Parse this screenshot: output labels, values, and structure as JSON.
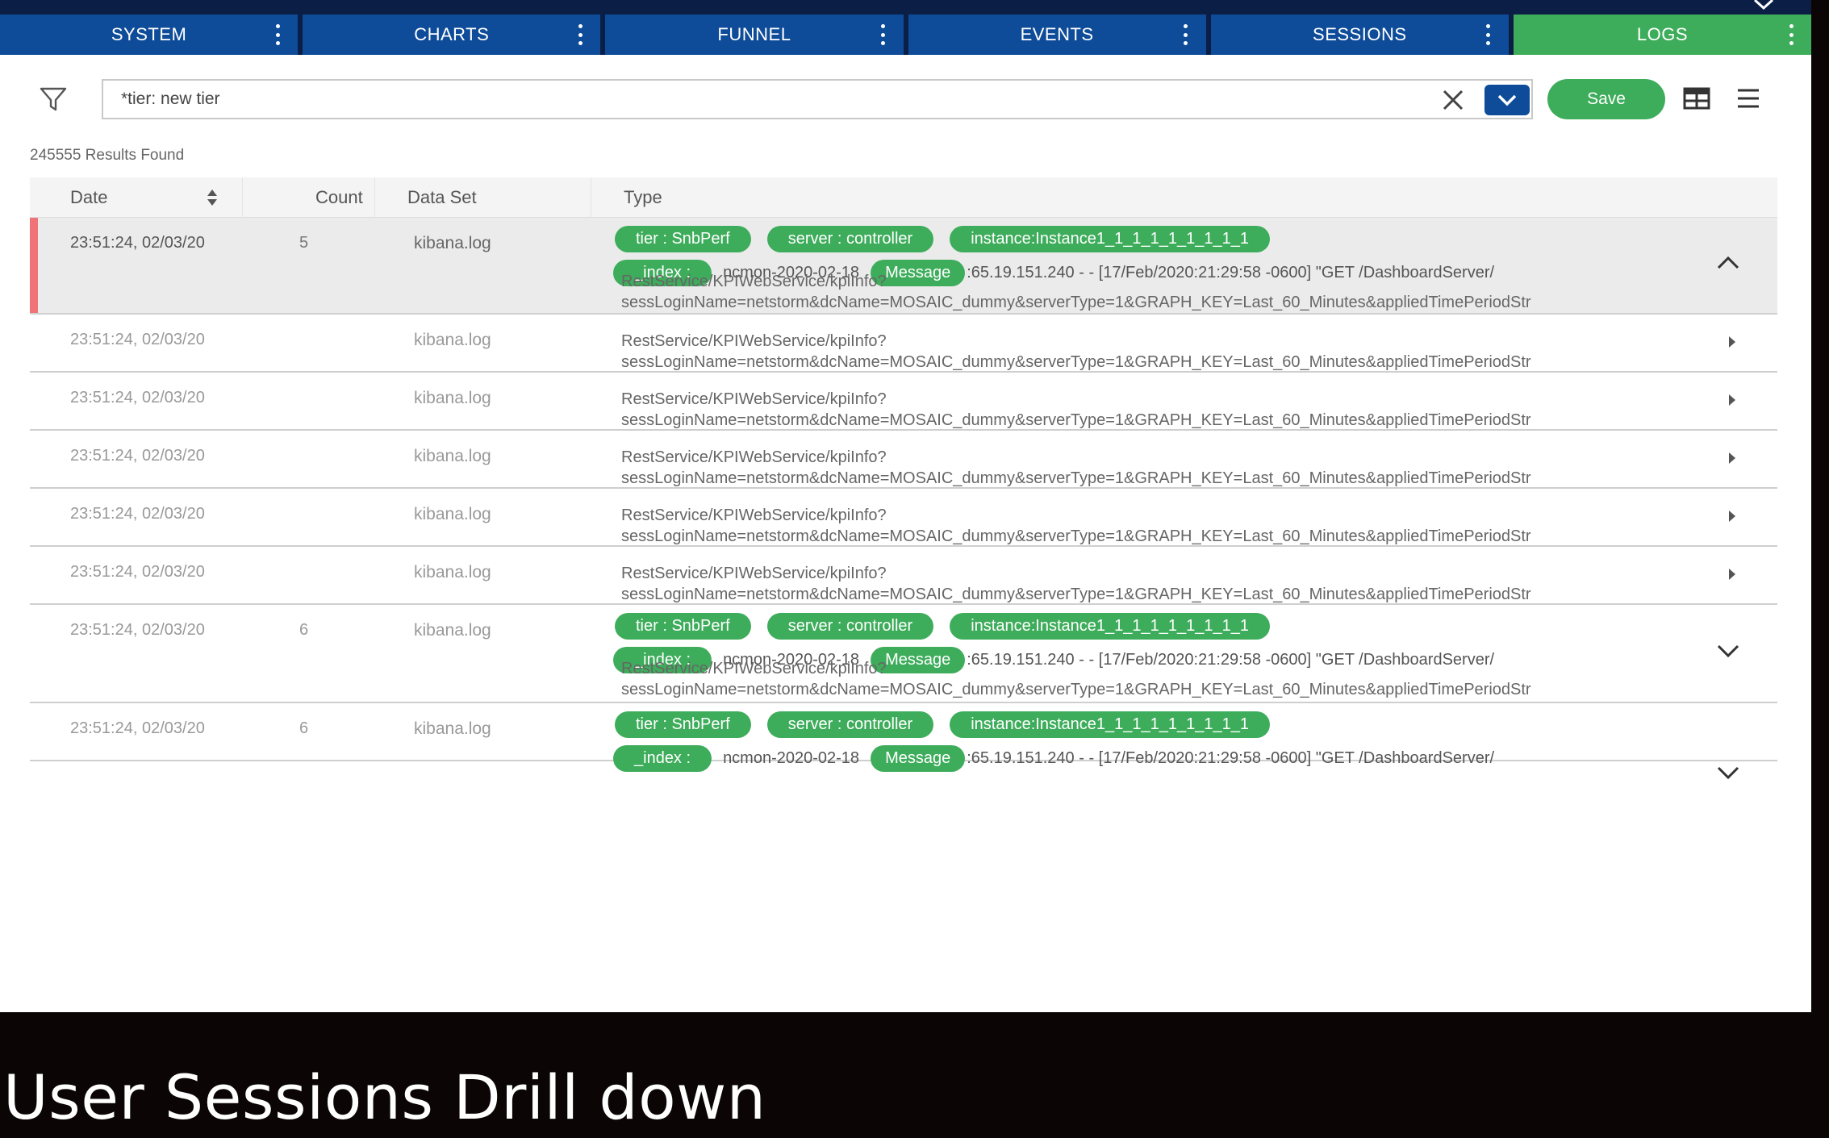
{
  "tabs": [
    {
      "label": "SYSTEM",
      "active": false
    },
    {
      "label": "CHARTS",
      "active": false
    },
    {
      "label": "FUNNEL",
      "active": false
    },
    {
      "label": "EVENTS",
      "active": false
    },
    {
      "label": "SESSIONS",
      "active": false
    },
    {
      "label": "LOGS",
      "active": true
    }
  ],
  "toolbar": {
    "search_value": "*tier: new tier",
    "save_label": "Save"
  },
  "results_label": "245555 Results Found",
  "table": {
    "headers": {
      "date": "Date",
      "count": "Count",
      "dataset": "Data Set",
      "type": "Type"
    },
    "tag_labels": {
      "tier": "tier : SnbPerf",
      "server": "server : controller",
      "instance": "instance:Instance1_1_1_1_1_1_1_1_1",
      "index": "_index :",
      "index_value": "ncmon-2020-02-18",
      "message": "Message",
      "message_text": ":65.19.151.240 - - [17/Feb/2020:21:29:58 -0600] \"GET /DashboardServer/"
    },
    "log_line1": "RestService/KPIWebService/kpiInfo?",
    "log_line2": "sessLoginName=netstorm&dcName=MOSAIC_dummy&serverType=1&GRAPH_KEY=Last_60_Minutes&appliedTimePeriodStr",
    "rows": [
      {
        "date": "23:51:24, 02/03/20",
        "count": "5",
        "dataset": "kibana.log",
        "expanded": true,
        "selected": true,
        "icon": "chevron-up-icon"
      },
      {
        "date": "23:51:24, 02/03/20",
        "count": "",
        "dataset": "kibana.log",
        "expanded": false,
        "icon": "caret-right-icon"
      },
      {
        "date": "23:51:24, 02/03/20",
        "count": "",
        "dataset": "kibana.log",
        "expanded": false,
        "icon": "caret-right-icon"
      },
      {
        "date": "23:51:24, 02/03/20",
        "count": "",
        "dataset": "kibana.log",
        "expanded": false,
        "icon": "caret-right-icon"
      },
      {
        "date": "23:51:24, 02/03/20",
        "count": "",
        "dataset": "kibana.log",
        "expanded": false,
        "icon": "caret-right-icon"
      },
      {
        "date": "23:51:24, 02/03/20",
        "count": "",
        "dataset": "kibana.log",
        "expanded": false,
        "icon": "caret-right-icon"
      },
      {
        "date": "23:51:24, 02/03/20",
        "count": "6",
        "dataset": "kibana.log",
        "expanded": true,
        "icon": "chevron-down-icon"
      },
      {
        "date": "23:51:24, 02/03/20",
        "count": "6",
        "dataset": "kibana.log",
        "expanded": true,
        "partial": true,
        "icon": "chevron-down-icon"
      }
    ]
  },
  "caption": "User Sessions Drill down",
  "colors": {
    "nav": "#0e4c99",
    "accent": "#3ead5b",
    "selection_marker": "#f07378"
  }
}
